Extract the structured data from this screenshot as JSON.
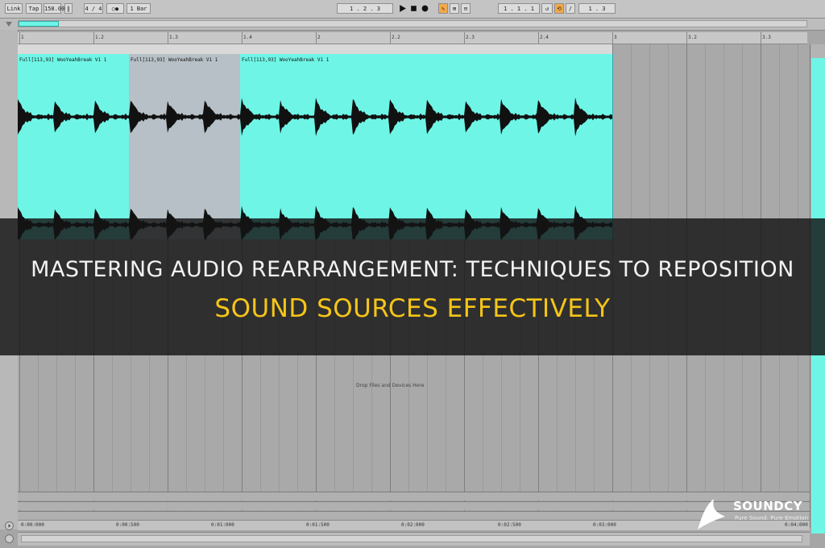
{
  "toolbar": {
    "link": "Link",
    "tap": "Tap",
    "tempo": "158.00",
    "time_sig": "4 / 4",
    "quantize": "1 Bar",
    "position": "1 .  2 .  3",
    "loop_start": "1 .  1 .  1",
    "loop_length": "1 .  3"
  },
  "ruler": {
    "ticks": [
      "1",
      "1.2",
      "1.3",
      "1.4",
      "2",
      "2.2",
      "2.3",
      "2.4",
      "3",
      "3.2",
      "3.3"
    ]
  },
  "clips": [
    {
      "name": "Full[113,93] WooYeahBreak V1 1",
      "selected": false
    },
    {
      "name": "Full[113,93] WooYeahBreak V1 1",
      "selected": true
    },
    {
      "name": "Full[113,93] WooYeahBreak V1 1",
      "selected": false
    }
  ],
  "drop_hint": "Drop Files and Devices Here",
  "timeline": {
    "labels": [
      "0:00:000",
      "0:00:500",
      "0:01:000",
      "0:01:500",
      "0:02:000",
      "0:02:500",
      "0:03:000",
      "0:04:000"
    ]
  },
  "banner": {
    "line1": "MASTERING AUDIO REARRANGEMENT: TECHNIQUES TO REPOSITION",
    "line2": "SOUND SOURCES EFFECTIVELY"
  },
  "logo": {
    "name": "SOUNDCY",
    "tagline": "Pure Sound. Pure Emotion"
  },
  "colors": {
    "clip": "#6ff5e6",
    "clip_selected": "#b6c0c6",
    "banner_title": "#f2f2f2",
    "banner_accent": "#f5c518"
  }
}
